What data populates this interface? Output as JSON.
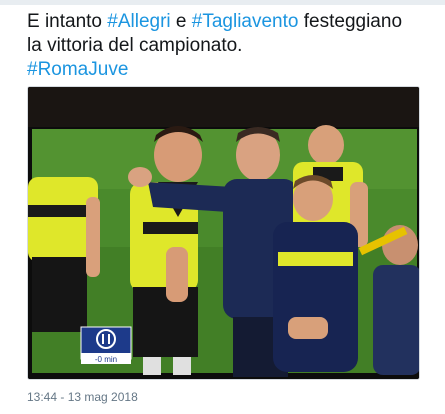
{
  "tweet": {
    "line1": {
      "prefix": "E intanto ",
      "tag1": "#Allegri",
      "middle": " e ",
      "tag2": "#Tagliavento",
      "suffix": " festeggiano"
    },
    "line2": "la vittoria del campionato.",
    "line3_tag": "#RomaJuve",
    "timestamp": "13:44 - 13 mag 2018"
  },
  "media": {
    "overlay_label": "-0 min"
  },
  "colors": {
    "hashtag": "#1b95e0",
    "text": "#14171a",
    "meta": "#657786",
    "pitch": "#4e8f2e",
    "referee_yellow": "#dfe72a",
    "coach_navy": "#1c2a55"
  }
}
